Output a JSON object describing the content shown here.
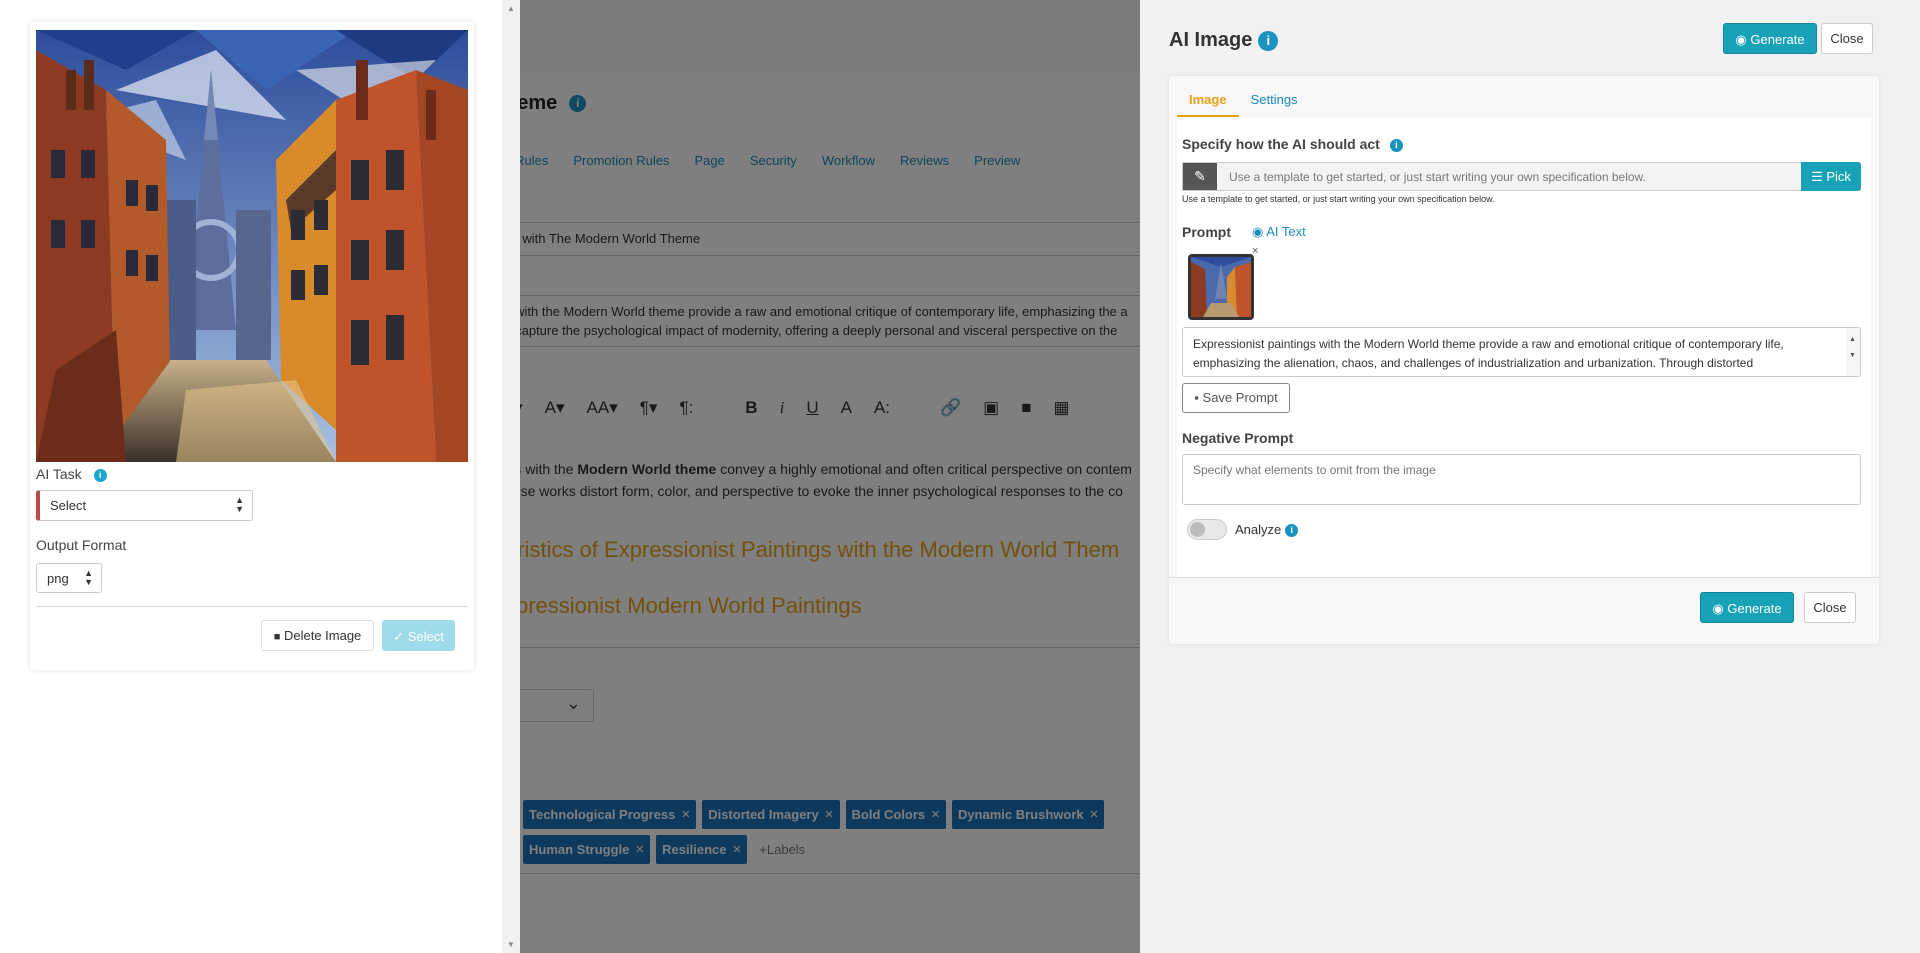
{
  "background_page": {
    "title": "heme",
    "tabs": [
      "s Rules",
      "Promotion Rules",
      "Page",
      "Security",
      "Workflow",
      "Reviews",
      "Preview"
    ],
    "field_title": "gs with The Modern World Theme",
    "field_desc_line1": "s with the Modern World theme provide a raw and emotional critique of contemporary life, emphasizing the a",
    "field_desc_line2": "s capture the psychological impact of modernity, offering a deeply personal and visceral perspective on the",
    "content_line1_a": "gs",
    "content_line1_b": " with the ",
    "content_line1_c": "Modern World theme",
    "content_line1_d": " convey a highly emotional and often critical perspective on contem",
    "content_line2": "hese works distort form, color, and perspective to evoke the inner psychological responses to the co",
    "heading1": "eristics of Expressionist Paintings with the Modern World Them",
    "heading2": "xpressionist Modern World Paintings",
    "tags_row1": [
      "Technological Progress",
      "Distorted Imagery",
      "Bold Colors",
      "Dynamic Brushwork"
    ],
    "tags_row2": [
      "Human Struggle",
      "Resilience"
    ],
    "add_labels": "+Labels"
  },
  "left_panel": {
    "ai_task_label": "AI Task",
    "ai_task_value": "Select",
    "output_format_label": "Output Format",
    "output_format_value": "png",
    "delete_button": "Delete Image",
    "select_button": "Select"
  },
  "right_panel": {
    "title": "AI Image",
    "generate_button": "Generate",
    "close_button": "Close",
    "tabs": [
      "Image",
      "Settings"
    ],
    "specify_label": "Specify how the AI should act",
    "template_placeholder": "Use a template to get started, or just start writing your own specification below.",
    "pick_button": "Pick",
    "template_help": "Use a template to get started, or just start writing your own specification below.",
    "prompt_label": "Prompt",
    "ai_text_link": "AI Text",
    "thumb_remove": "×",
    "prompt_text": "Expressionist paintings with the Modern World theme provide a raw and emotional critique of contemporary life, emphasizing the alienation, chaos, and challenges of industrialization and urbanization. Through distorted",
    "save_prompt_button": "Save Prompt",
    "negative_prompt_label": "Negative Prompt",
    "negative_prompt_placeholder": "Specify what elements to omit from the image",
    "analyze_label": "Analyze"
  },
  "icons": {
    "info": "i",
    "pencil": "✎",
    "list": "☰",
    "trash": "🗑",
    "thumbs_up": "👍",
    "robot": "🤖",
    "save": "💾"
  },
  "colors": {
    "accent_blue": "#17a2b8",
    "tab_active": "#e7a21b",
    "tag_blue": "#1b72b8",
    "required_red": "#b94a48"
  }
}
